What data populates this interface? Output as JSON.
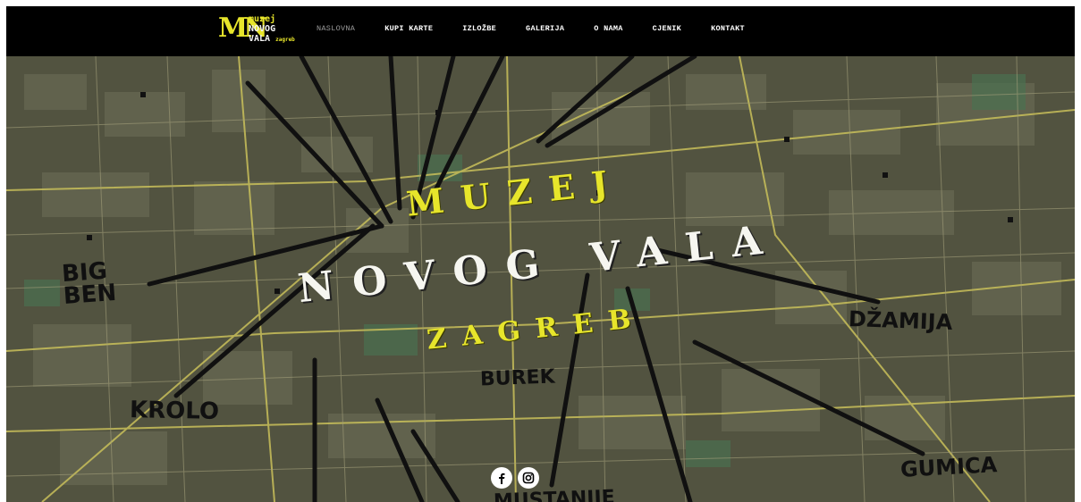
{
  "logo": {
    "mark": "MN",
    "line1": "muzej",
    "line2": "NOVOG",
    "line3": "VALA",
    "line4": "zagreb"
  },
  "nav": [
    {
      "label": "NASLOVNA",
      "active": true
    },
    {
      "label": "KUPI KARTE",
      "active": false
    },
    {
      "label": "IZLOŽBE",
      "active": false
    },
    {
      "label": "GALERIJA",
      "active": false
    },
    {
      "label": "O NAMA",
      "active": false
    },
    {
      "label": "CJENIK",
      "active": false
    },
    {
      "label": "KONTAKT",
      "active": false
    }
  ],
  "hero": {
    "title_line1": "MUZEJ",
    "title_line2": "NOVOG VALA",
    "title_line3": "ZAGREB",
    "map_labels": {
      "bigben": "BIG\nBEN",
      "dzamija": "DŽAMIJA",
      "krolo": "KROLO",
      "burek": "BUREK",
      "gumica": "GUMICA",
      "mustanije": "MUSTANIJE"
    }
  },
  "social": {
    "facebook_icon": "facebook-icon",
    "instagram_icon": "instagram-icon"
  },
  "colors": {
    "accent_yellow": "#e7e52b",
    "nav_bg": "#000000",
    "map_base": "#51523c"
  }
}
